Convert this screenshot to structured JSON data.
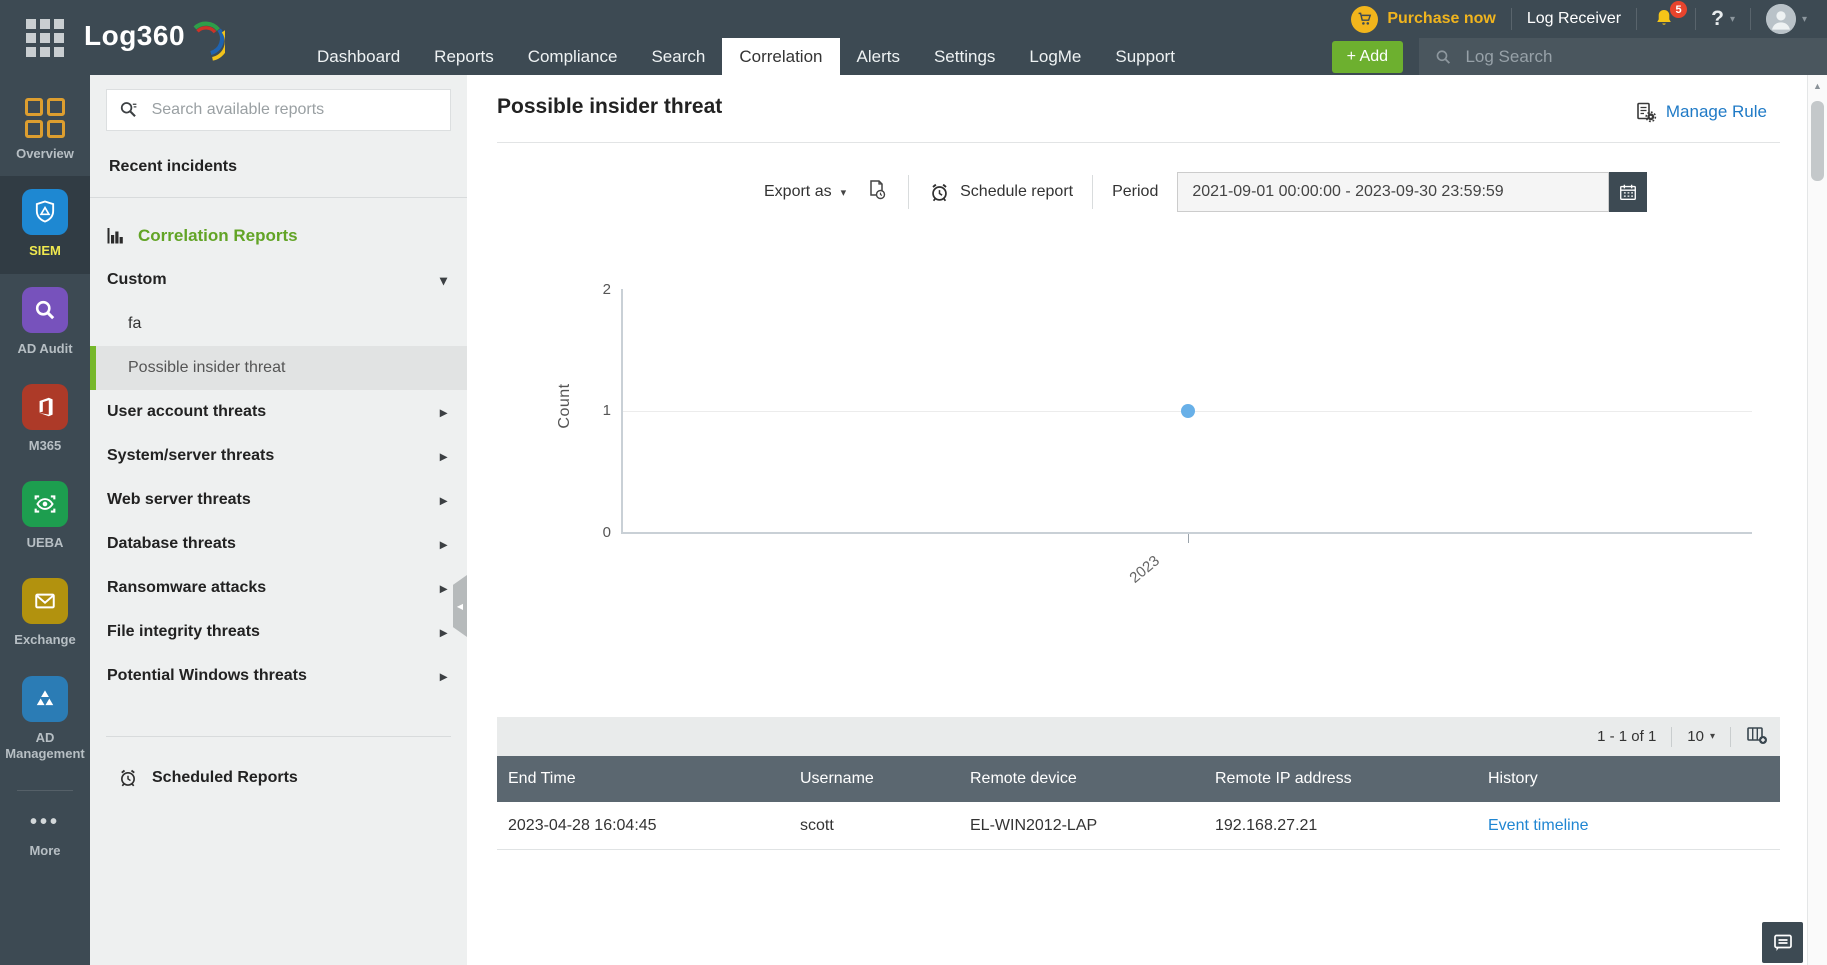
{
  "colors": {
    "topbar_bg": "#3d4a53",
    "accent_green": "#76b82a",
    "heading_green": "#62a426",
    "link_blue": "#2086d2",
    "manage_blue": "#1f7ac6",
    "add_green": "#6db02f",
    "purchase_gold": "#f0b41e",
    "bell_yellow": "#f5c518",
    "badge_red": "#e8442d",
    "table_header_slate": "#5b6770",
    "dot_blue": "#68b0e8",
    "siem_active_yellow": "#f0e94f"
  },
  "topbar": {
    "logo": "Log360",
    "purchase_now": "Purchase now",
    "log_receiver": "Log Receiver",
    "notification_count": "5",
    "help_label": "?",
    "nav": [
      "Dashboard",
      "Reports",
      "Compliance",
      "Search",
      "Correlation",
      "Alerts",
      "Settings",
      "LogMe",
      "Support"
    ],
    "add_button": "+ Add",
    "log_search_placeholder": "Log Search"
  },
  "rail": {
    "items": [
      "Overview",
      "SIEM",
      "AD Audit",
      "M365",
      "UEBA",
      "Exchange",
      "AD Management"
    ],
    "more_label": "More"
  },
  "sidebar": {
    "search_placeholder": "Search available reports",
    "recent_incidents": "Recent incidents",
    "section_title": "Correlation Reports",
    "custom_group": "Custom",
    "custom_children": [
      "fa",
      "Possible insider threat"
    ],
    "groups": [
      "User account threats",
      "System/server threats",
      "Web server threats",
      "Database threats",
      "Ransomware attacks",
      "File integrity threats",
      "Potential Windows threats"
    ],
    "scheduled_reports": "Scheduled Reports"
  },
  "main": {
    "title": "Possible insider threat",
    "manage_rule": "Manage Rule",
    "toolbar": {
      "export_label": "Export as",
      "schedule_label": "Schedule report",
      "period_label": "Period",
      "period_value": "2021-09-01 00:00:00 - 2023-09-30 23:59:59"
    },
    "pagination": {
      "range": "1 - 1 of 1",
      "page_size": "10"
    },
    "table": {
      "columns": [
        "End Time",
        "Username",
        "Remote device",
        "Remote IP address",
        "History"
      ],
      "rows": [
        {
          "end_time": "2023-04-28 16:04:45",
          "username": "scott",
          "remote_device": "EL-WIN2012-LAP",
          "remote_ip": "192.168.27.21",
          "history_link": "Event timeline"
        }
      ]
    }
  },
  "chart_data": {
    "type": "scatter",
    "x": [
      "2023"
    ],
    "series": [
      {
        "name": "Count",
        "values": [
          1
        ]
      }
    ],
    "title": "",
    "xlabel": "",
    "ylabel": "Count",
    "ylim": [
      0,
      2
    ],
    "yticks": [
      "2",
      "1",
      "0"
    ],
    "grid": "horizontal gridline at y=1 only",
    "legend": "none",
    "point_color": "#68b0e8"
  }
}
